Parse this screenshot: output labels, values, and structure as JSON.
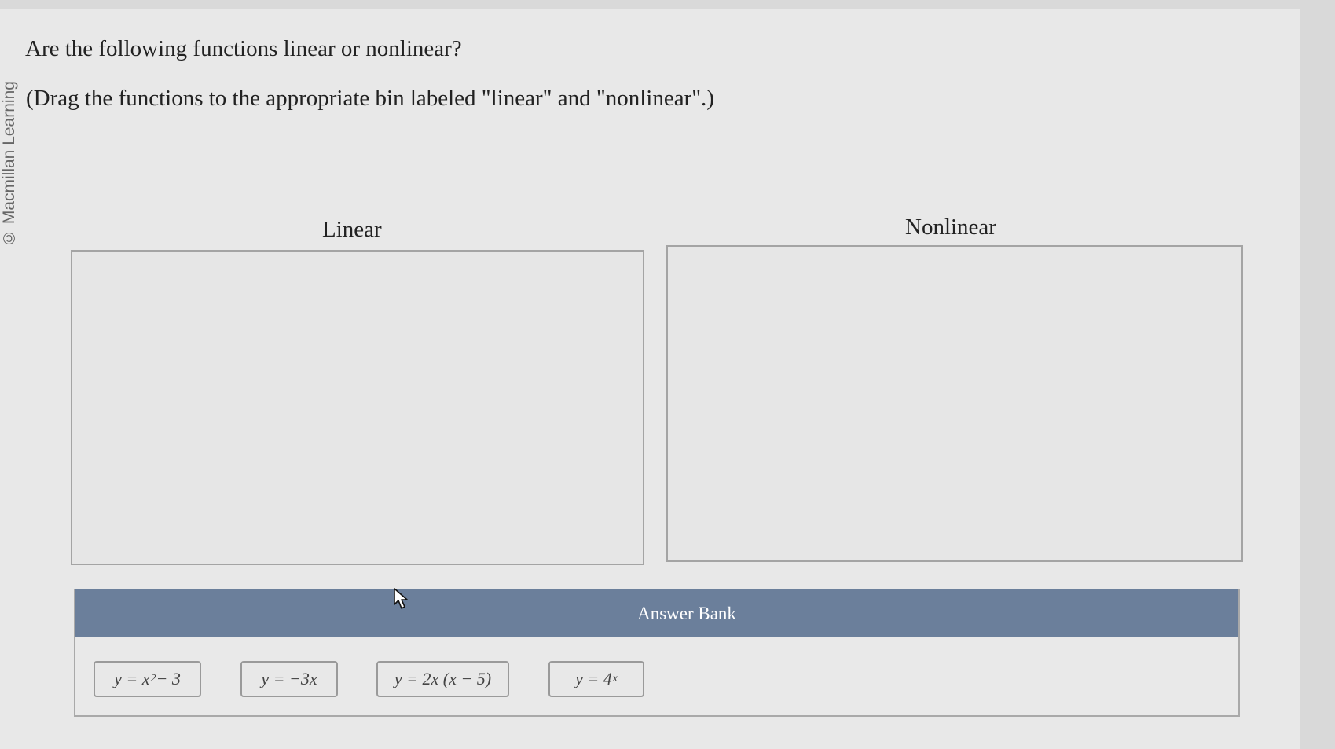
{
  "watermark": "© Macmillan Learning",
  "question": "Are the following functions linear or nonlinear?",
  "instruction": "(Drag the functions to the appropriate bin labeled \"linear\" and \"nonlinear\".)",
  "bins": {
    "linear_label": "Linear",
    "nonlinear_label": "Nonlinear"
  },
  "answer_bank": {
    "title": "Answer Bank",
    "items": [
      {
        "base": "y = x",
        "sup": "2",
        "tail": " − 3"
      },
      {
        "base": "y = −3x",
        "sup": "",
        "tail": ""
      },
      {
        "base": "y = 2x (x − 5)",
        "sup": "",
        "tail": ""
      },
      {
        "base": "y = 4",
        "sup": "x",
        "tail": ""
      }
    ]
  },
  "colors": {
    "answer_bank_header": "#6b7f9b",
    "page_background": "#e8e8e8"
  },
  "icons": {
    "cursor": "arrow-pointer-icon"
  }
}
